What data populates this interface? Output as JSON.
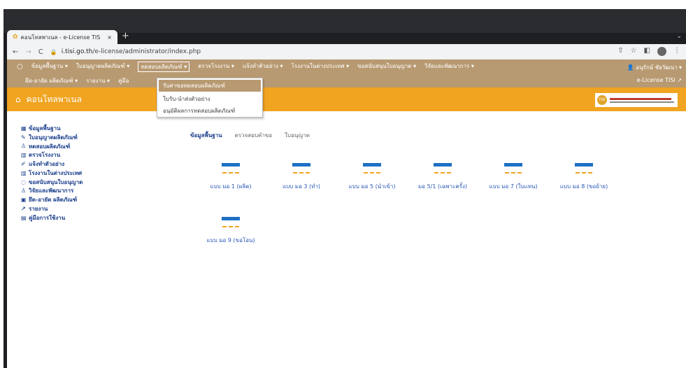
{
  "browser": {
    "tab_title": "คอนโทลพาเนล - e-License TIS",
    "tab_close": "×",
    "new_tab": "+",
    "window_controls": "⌄",
    "url_host": "i.tisi.go.th",
    "url_path": "/e-license/administrator/index.php"
  },
  "topnav": {
    "row1": [
      {
        "label": "ข้อมูลพื้นฐาน ▾"
      },
      {
        "label": "ใบอนุญาตผลิตภัณฑ์ ▾"
      },
      {
        "label": "ทดสอบผลิตภัณฑ์ ▾",
        "active": true
      },
      {
        "label": "ตรวจโรงงาน ▾"
      },
      {
        "label": "แจ้งทำตัวอย่าง ▾"
      },
      {
        "label": "โรงงานในต่างประเทศ ▾"
      },
      {
        "label": "ขอสนับสนุนใบอนุญาต ▾"
      },
      {
        "label": "วิจัยและพัฒนาการ ▾"
      }
    ],
    "row2": [
      {
        "label": "ยึด-อายัด ผลิตภัณฑ์ ▾"
      },
      {
        "label": "รายงาน ▾"
      },
      {
        "label": "คู่มือ"
      }
    ],
    "user": "👤 อนุรักษ์ ชัยวัฒนา ▾",
    "system": "e-License TISI ↗"
  },
  "dropdown": {
    "items": [
      {
        "label": "รับค่าขอทดสอบผลิตภัณฑ์",
        "highlight": true
      },
      {
        "label": "ใบรับ-นำส่งตัวอย่าง"
      },
      {
        "label": "อนุมัติผลการทดสอบผลิตภัณฑ์"
      }
    ]
  },
  "banner": {
    "title": "คอนโทลพาเนล"
  },
  "sidebar": {
    "items": [
      {
        "icon": "▦",
        "label": "ข้อมูลพื้นฐาน"
      },
      {
        "icon": "✎",
        "label": "ใบอนุญาตผลิตภัณฑ์"
      },
      {
        "icon": "♙",
        "label": "ทดสอบผลิตภัณฑ์"
      },
      {
        "icon": "▥",
        "label": "ตรวจโรงงาน"
      },
      {
        "icon": "✐",
        "label": "แจ้งทำตัวอย่าง"
      },
      {
        "icon": "▥",
        "label": "โรงงานในต่างประเทศ"
      },
      {
        "icon": "◌",
        "label": "ขอสนับสนุนใบอนุญาต"
      },
      {
        "icon": "♙",
        "label": "วิจัยและพัฒนาการ"
      },
      {
        "icon": "▣",
        "label": "ยึด-อายัด ผลิตภัณฑ์"
      },
      {
        "icon": "↗",
        "label": "รายงาน"
      },
      {
        "icon": "▤",
        "label": "คู่มือการใช้งาน"
      }
    ]
  },
  "content": {
    "tabs": [
      {
        "label": "ข้อมูลพื้นฐาน",
        "active": true
      },
      {
        "label": "ตรวจสอบคำขอ"
      },
      {
        "label": "ใบอนุญาต"
      }
    ],
    "forms": [
      {
        "label": "แบบ มอ 1 (ผลิต)"
      },
      {
        "label": "แบบ มอ 3 (ทำ)"
      },
      {
        "label": "แบบ มอ 5 (นำเข้า)"
      },
      {
        "label": "มอ 5/1 (เฉพาะครั้ง)"
      },
      {
        "label": "แบบ มอ 7 (ใบแทน)"
      },
      {
        "label": "แบบ มอ 8 (ขอย้าย)"
      },
      {
        "label": "แบบ มอ 9 (ขอโอน)"
      }
    ]
  },
  "colors": {
    "nav": "#b89a72",
    "banner": "#f0a420",
    "link": "#1a3e8c",
    "form_bar": "#1f6fc5"
  }
}
